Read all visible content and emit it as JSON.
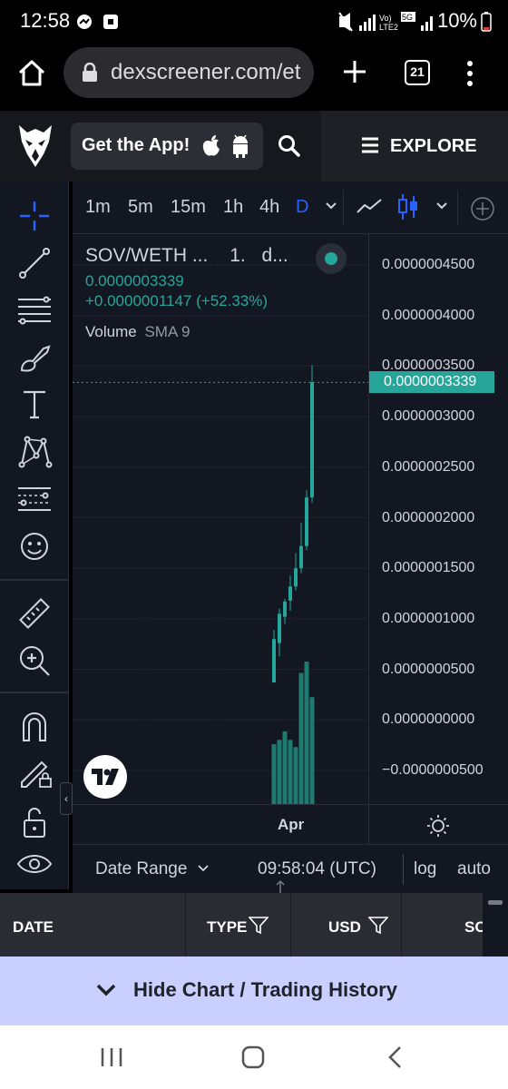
{
  "status_bar": {
    "time": "12:58",
    "battery": "10%",
    "network_label": "5G"
  },
  "browser": {
    "url": "dexscreener.com/et",
    "tab_count": "21"
  },
  "header": {
    "get_app_label": "Get the App!",
    "explore_label": "EXPLORE"
  },
  "chart_toolbar": {
    "timeframes": [
      "1m",
      "5m",
      "15m",
      "1h",
      "4h",
      "D"
    ],
    "active_timeframe": "D"
  },
  "legend": {
    "symbol": "SOV/WETH ...",
    "interval": "1.",
    "exchange": "d...",
    "price": "0.0000003339",
    "change": "+0.0000001147 (+52.33%)",
    "volume_label": "Volume",
    "volume_indicator": "SMA 9"
  },
  "colors": {
    "up": "#26a69a",
    "background": "#131722",
    "accent_blue": "#2962ff"
  },
  "chart_data": {
    "type": "candlestick",
    "current_price": "0.0000003339",
    "ylim": [
      -5e-08,
      4.5e-07
    ],
    "y_ticks": [
      "0.0000004500",
      "0.0000004000",
      "0.0000003500",
      "0.0000003000",
      "0.0000002500",
      "0.0000002000",
      "0.0000001500",
      "0.0000001000",
      "0.0000000500",
      "0.0000000000",
      "−0.0000000500"
    ],
    "x_ticks": [
      "Apr"
    ],
    "candles": [
      {
        "open": 3.7e-08,
        "high": 8.9e-08,
        "low": 3.7e-08,
        "close": 8e-08
      },
      {
        "open": 7.6e-08,
        "high": 1.1e-07,
        "low": 6.3e-08,
        "close": 1.05e-07
      },
      {
        "open": 1.02e-07,
        "high": 1.2e-07,
        "low": 9.5e-08,
        "close": 1.17e-07
      },
      {
        "open": 1.18e-07,
        "high": 1.43e-07,
        "low": 1.08e-07,
        "close": 1.32e-07
      },
      {
        "open": 1.32e-07,
        "high": 1.65e-07,
        "low": 1.28e-07,
        "close": 1.5e-07
      },
      {
        "open": 1.5e-07,
        "high": 1.95e-07,
        "low": 1.45e-07,
        "close": 1.72e-07
      },
      {
        "open": 1.72e-07,
        "high": 2.27e-07,
        "low": 1.68e-07,
        "close": 2.2e-07
      },
      {
        "open": 2.2e-07,
        "high": 3.51e-07,
        "low": 2.15e-07,
        "close": 3.34e-07
      }
    ],
    "volumes": [
      0.42,
      0.45,
      0.51,
      0.45,
      0.4,
      0.92,
      1.0,
      0.75
    ]
  },
  "time_axis": {
    "month_label": "Apr"
  },
  "bottom_bar": {
    "date_range": "Date Range",
    "clock": "09:58:04 (UTC)",
    "log": "log",
    "auto": "auto"
  },
  "table": {
    "columns": [
      "DATE",
      "TYPE",
      "USD",
      "SO"
    ]
  },
  "hide_chart_label": "Hide Chart / Trading History"
}
